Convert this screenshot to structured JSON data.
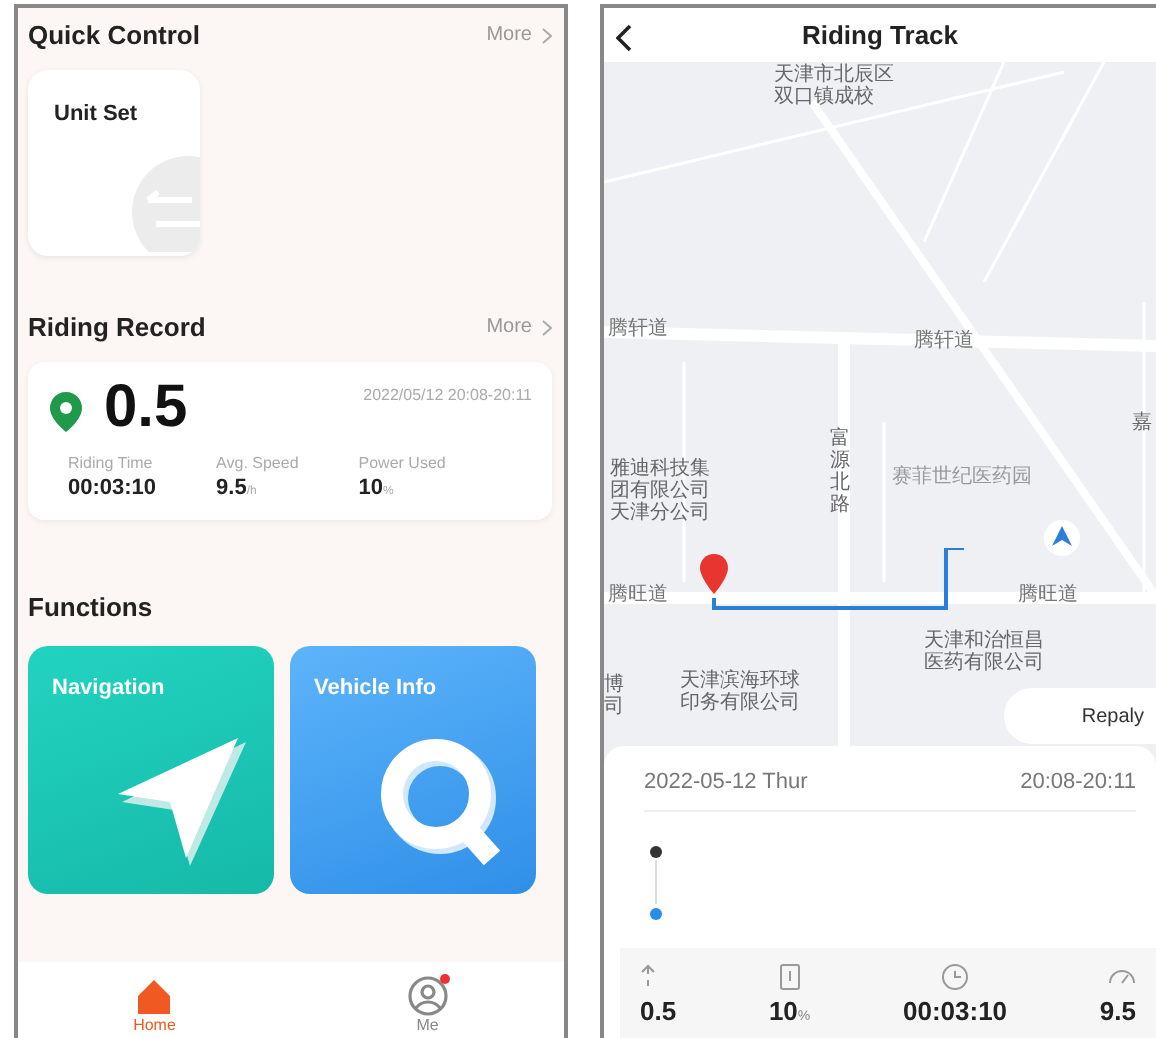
{
  "home_screen": {
    "quick_control": {
      "title": "Quick Control",
      "more": "More"
    },
    "quick_items": [
      {
        "label": "Unit Set"
      }
    ],
    "riding_record": {
      "title": "Riding Record",
      "more": "More",
      "distance": "0.5",
      "datetime": "2022/05/12 20:08-20:11",
      "stats": [
        {
          "label": "Riding Time",
          "value": "00:03:10"
        },
        {
          "label": "Avg. Speed",
          "value": "9.5",
          "unit": "/h"
        },
        {
          "label": "Power Used",
          "value": "10",
          "unit": "%"
        }
      ]
    },
    "functions": {
      "title": "Functions",
      "cards": [
        {
          "label": "Navigation",
          "kind": "navigation"
        },
        {
          "label": "Vehicle Info",
          "kind": "vehicle"
        }
      ]
    },
    "tab_bar": [
      {
        "label": "Home",
        "kind": "home",
        "selected": true,
        "badge": false
      },
      {
        "label": "Me",
        "kind": "me",
        "selected": false,
        "badge": true
      }
    ]
  },
  "track_screen": {
    "title": "Riding Track",
    "map_labels": [
      {
        "text": "天津市北辰区双口镇成校",
        "kind": "place"
      },
      {
        "text": "腾轩道",
        "kind": "road"
      },
      {
        "text": "腾轩道",
        "kind": "road"
      },
      {
        "text": "雅迪科技集团有限公司天津分公司",
        "kind": "place"
      },
      {
        "text": "富源北路",
        "kind": "vertical"
      },
      {
        "text": "赛菲世纪医药园",
        "kind": "area"
      },
      {
        "text": "嘉",
        "kind": "place"
      },
      {
        "text": "腾旺道",
        "kind": "road"
      },
      {
        "text": "腾旺道",
        "kind": "road"
      },
      {
        "text": "博司",
        "kind": "place"
      },
      {
        "text": "天津和治恒昌医药有限公司",
        "kind": "place"
      },
      {
        "text": "天津滨海环球印务有限公司",
        "kind": "place"
      }
    ],
    "replay_button": "Repaly",
    "date": "2022-05-12 Thur",
    "time_range": "20:08-20:11",
    "stats": [
      {
        "kind": "distance",
        "value": "0.5"
      },
      {
        "kind": "battery",
        "value": "10",
        "unit": "%"
      },
      {
        "kind": "clock",
        "value": "00:03:10"
      },
      {
        "kind": "speed",
        "value": "9.5"
      }
    ]
  }
}
